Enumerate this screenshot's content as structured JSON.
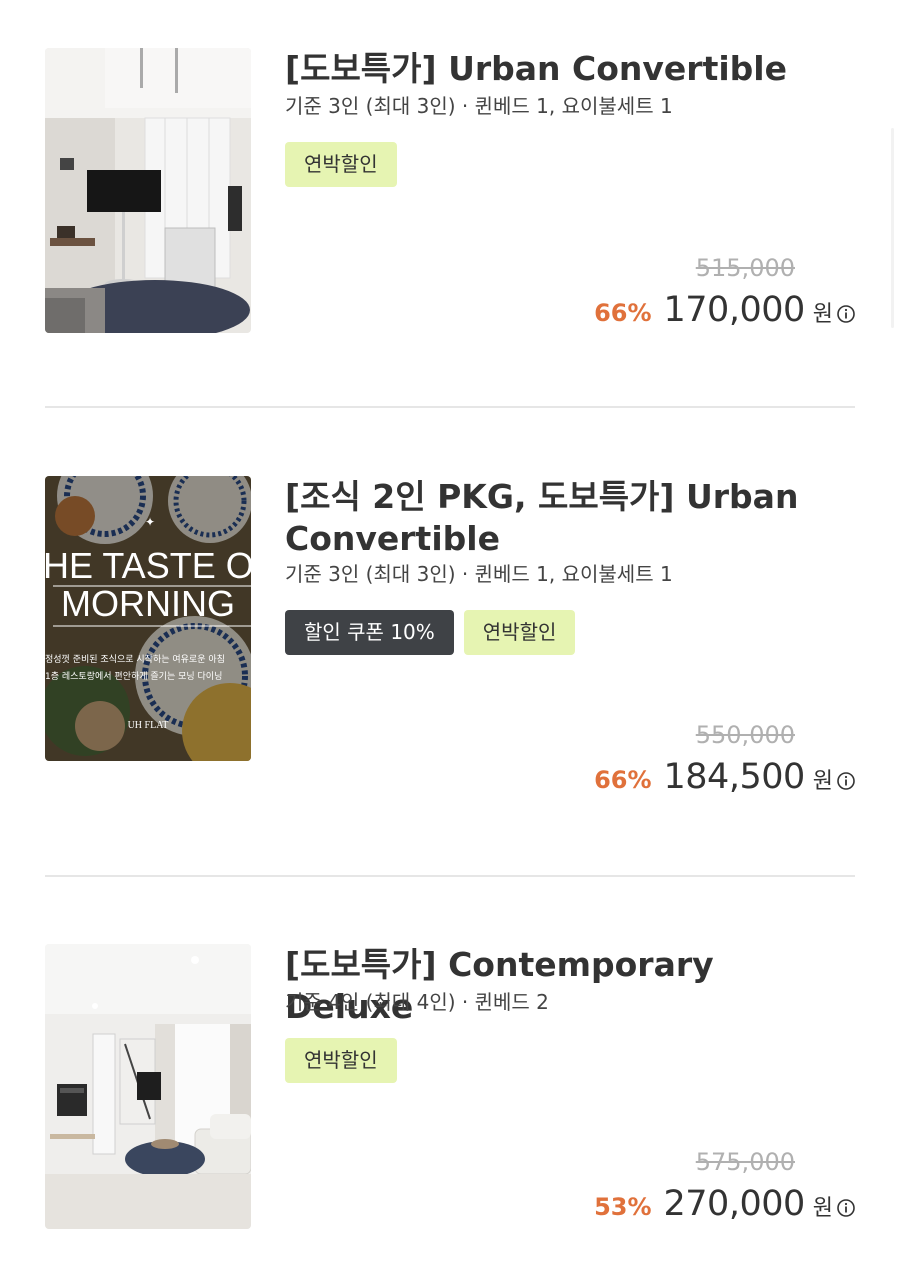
{
  "rooms": [
    {
      "title": "[도보특가] Urban Convertible",
      "meta": "기준 3인 (최대 3인) ·  퀸베드 1, 요이불세트 1",
      "badges": [
        "연박할인"
      ],
      "original_price": "515,000",
      "discount": "66%",
      "price": "170,000",
      "currency": "원",
      "image": "room-interior-loft-tv"
    },
    {
      "title": "[조식 2인 PKG, 도보특가] Urban Convertible",
      "meta": "기준 3인 (최대 3인) ·  퀸베드 1, 요이불세트 1",
      "coupon_badge": "할인 쿠폰 10%",
      "badges": [
        "연박할인"
      ],
      "original_price": "550,000",
      "discount": "66%",
      "price": "184,500",
      "currency": "원",
      "image": "breakfast-promo",
      "image_text": {
        "headline_1": "HE TASTE O",
        "headline_2": "MORNING",
        "line_1": "정성껏 준비된 조식으로 시작하는 여유로운 아침",
        "line_2": "1층 레스토랑에서 편안하게 즐기는 모닝 다이닝",
        "brand": "UH FLAT"
      }
    },
    {
      "title": "[도보특가] Contemporary Deluxe",
      "meta": "기준 4인 (최대 4인) ·  퀸베드 2",
      "badges": [
        "연박할인"
      ],
      "original_price": "575,000",
      "discount": "53%",
      "price": "270,000",
      "currency": "원",
      "image": "room-interior-duplex-sofa"
    }
  ],
  "colors": {
    "discount": "#e0713b",
    "badge_green": "#e6f4b2",
    "badge_dark": "#3f4246",
    "divider": "#e6e6e6"
  },
  "icons": [
    "info-icon"
  ]
}
